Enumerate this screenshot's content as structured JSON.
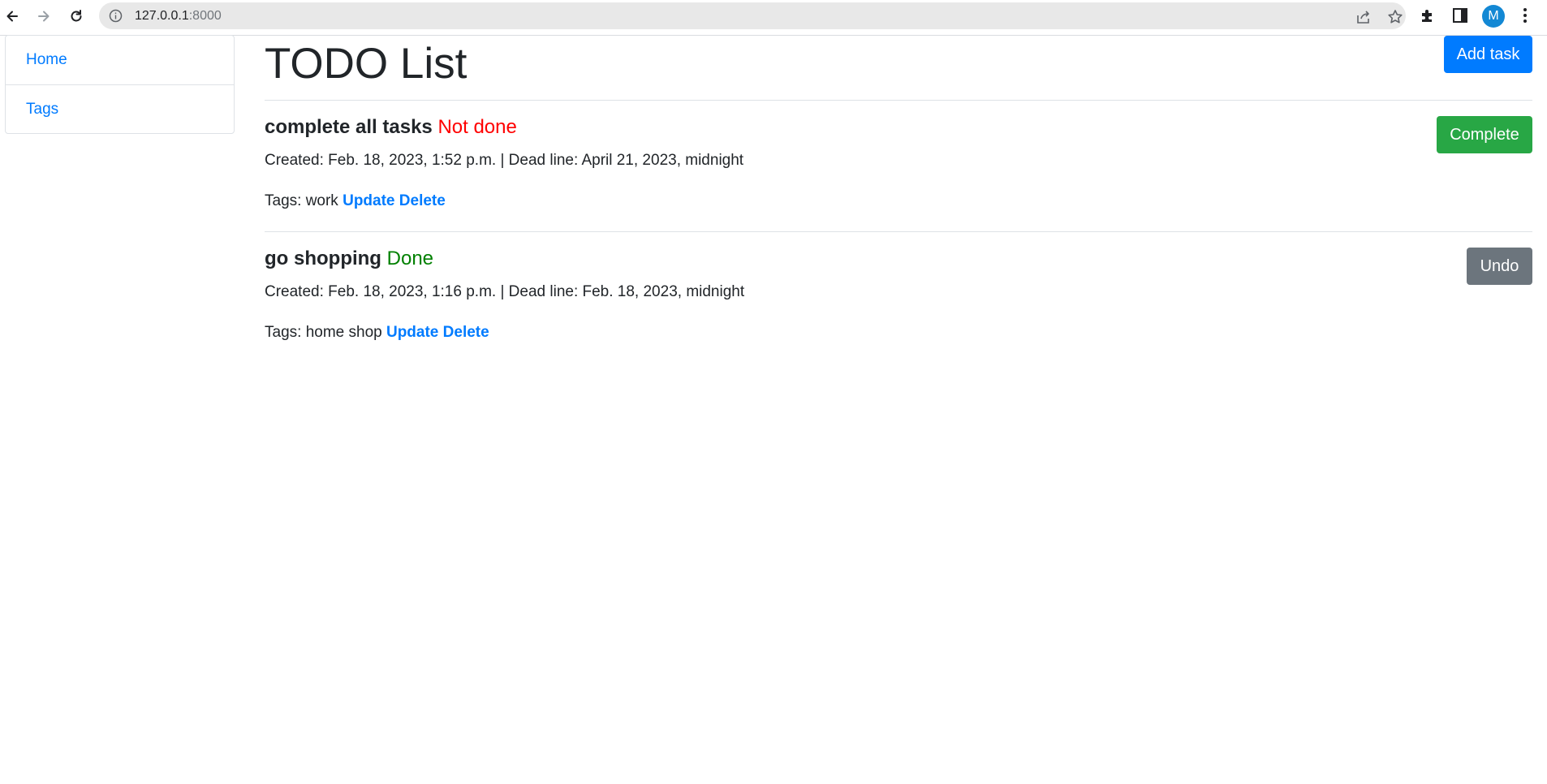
{
  "browser": {
    "url_host": "127.0.0.1",
    "url_port": ":8000",
    "profile_initial": "M"
  },
  "sidebar": {
    "items": [
      {
        "label": "Home"
      },
      {
        "label": "Tags"
      }
    ]
  },
  "main": {
    "title": "TODO List",
    "add_button": "Add task",
    "tasks": [
      {
        "name": "complete all tasks",
        "status": "Not done",
        "status_color": "#ff0000",
        "meta": "Created: Feb. 18, 2023, 1:52 p.m. | Dead line: April 21, 2023, midnight",
        "tags_prefix": "Tags: work",
        "update_label": "Update",
        "delete_label": "Delete",
        "action_label": "Complete",
        "action_color": "#28a745"
      },
      {
        "name": "go shopping",
        "status": "Done",
        "status_color": "#008000",
        "meta": "Created: Feb. 18, 2023, 1:16 p.m. | Dead line: Feb. 18, 2023, midnight",
        "tags_prefix": "Tags: home shop",
        "update_label": "Update",
        "delete_label": "Delete",
        "action_label": "Undo",
        "action_color": "#6c757d"
      }
    ]
  }
}
